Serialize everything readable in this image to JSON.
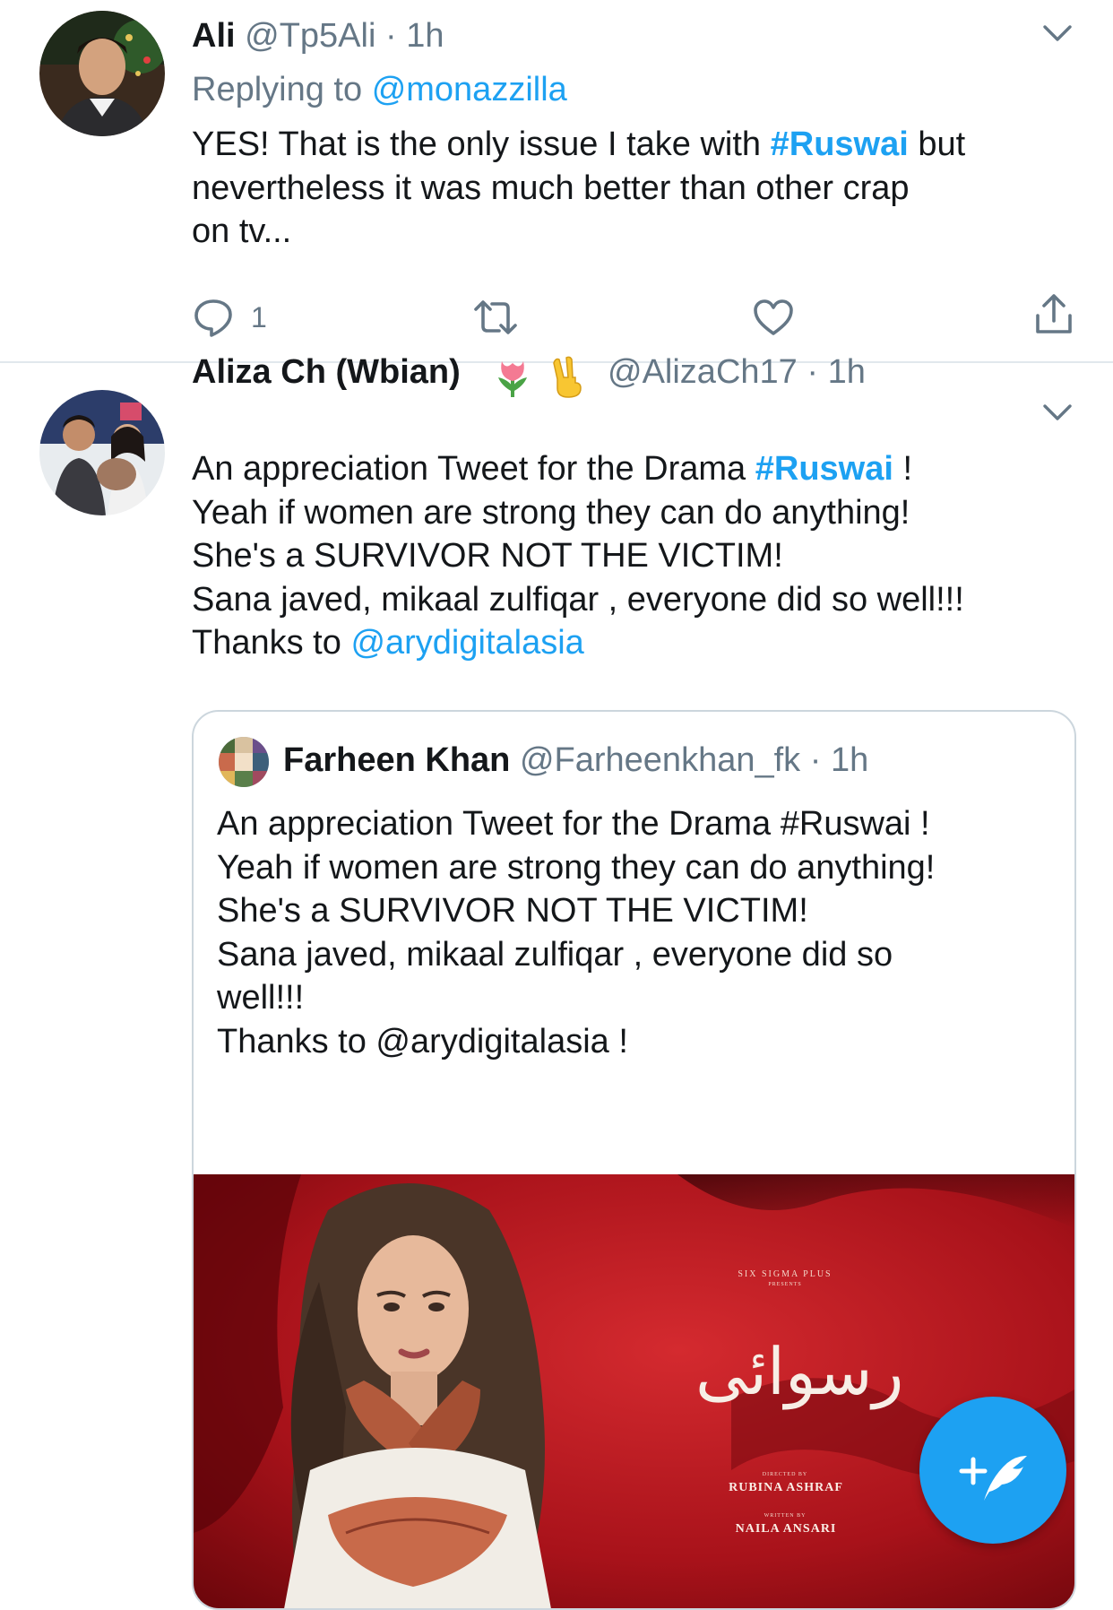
{
  "tweet1": {
    "name": "Ali",
    "handle": "@Tp5Ali",
    "separator": "·",
    "time": "1h",
    "reply_prefix": "Replying to",
    "reply_to": "@monazzilla",
    "text_part1": "YES! That is the only issue I take with",
    "hashtag": "#Ruswai",
    "text_part2": "but",
    "text_line2": "nevertheless it was much better than other crap",
    "text_line3": "on tv...",
    "reply_count": "1"
  },
  "tweet2": {
    "name": "Aliza Ch (Wbian)",
    "handle": "@AlizaCh17",
    "separator": "·",
    "time": "1h",
    "line1_prefix": "An appreciation Tweet for the Drama",
    "hashtag": "#Ruswai",
    "line1_suffix": "!",
    "line2": "Yeah if women are strong they can do anything!",
    "line3": "She's a SURVIVOR NOT THE VICTIM!",
    "line4": "Sana javed, mikaal zulfiqar , everyone did so well!!!",
    "line5_prefix": "Thanks to",
    "mention": "@arydigitalasia"
  },
  "quoted": {
    "name": "Farheen Khan",
    "handle": "@Farheenkhan_fk",
    "separator": "·",
    "time": "1h",
    "lines": [
      "An appreciation Tweet for the Drama #Ruswai !",
      "Yeah if women are strong they can do anything!",
      "She's a SURVIVOR NOT THE VICTIM!",
      "Sana javed, mikaal zulfiqar , everyone did so",
      "well!!!",
      "Thanks to @arydigitalasia !"
    ],
    "poster": {
      "producer": "SIX SIGMA PLUS",
      "presents": "PRESENTS",
      "title": "رسوائی",
      "directed_by": "DIRECTED BY",
      "director": "RUBINA ASHRAF",
      "written_by": "WRITTEN BY",
      "writer": "NAILA ANSARI"
    }
  },
  "colors": {
    "accent": "#1da1f2",
    "muted": "#657786",
    "text": "#14171a",
    "divider": "#e1e8ed",
    "poster_red": "#b3141a"
  },
  "icons": [
    "reply-icon",
    "retweet-icon",
    "like-icon",
    "share-icon",
    "chevron-down-icon",
    "tulip-emoji",
    "victory-hand-emoji",
    "compose-tweet-icon"
  ]
}
